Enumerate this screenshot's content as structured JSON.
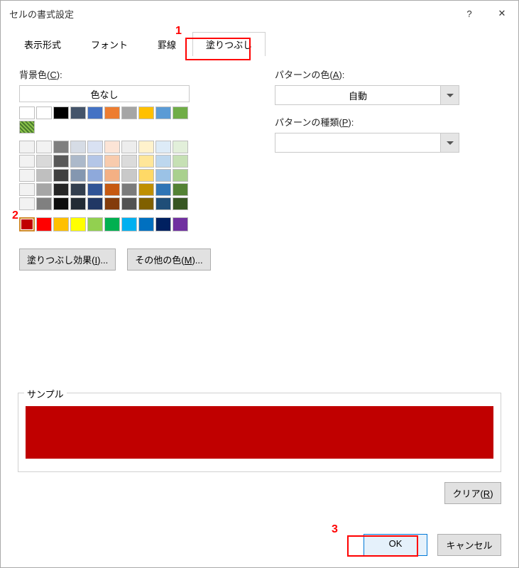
{
  "title": "セルの書式設定",
  "help_icon": "?",
  "close_icon": "✕",
  "tabs": {
    "t0": "表示形式",
    "t1": "フォント",
    "t2": "罫線",
    "t3": "塗りつぶし"
  },
  "bg": {
    "label_pre": "背景色(",
    "label_ul": "C",
    "label_post": "):",
    "nocolor": "色なし"
  },
  "fill_effects": {
    "pre": "塗りつぶし効果(",
    "ul": "I",
    "post": ")..."
  },
  "other_colors": {
    "pre": "その他の色(",
    "ul": "M",
    "post": ")..."
  },
  "pattern_color": {
    "pre": "パターンの色(",
    "ul": "A",
    "post": "):",
    "value": "自動"
  },
  "pattern_type": {
    "pre": "パターンの種類(",
    "ul": "P",
    "post": "):",
    "value": ""
  },
  "sample_label": "サンプル",
  "sample_color": "#c00000",
  "clear": {
    "pre": "クリア(",
    "ul": "R",
    "post": ")"
  },
  "ok": "OK",
  "cancel": "キャンセル",
  "annotations": {
    "a1": "1",
    "a2": "2",
    "a3": "3"
  },
  "palette_row1": [
    "#ffffff",
    "#000000",
    "#44546a",
    "#4472c4",
    "#ed7d31",
    "#a5a5a5",
    "#ffc000",
    "#5b9bd5",
    "#70ad47"
  ],
  "palette_grid": [
    [
      "#f2f2f2",
      "#7f7f7f",
      "#d6dce5",
      "#d9e1f2",
      "#fce4d6",
      "#ededed",
      "#fff2cc",
      "#ddebf7",
      "#e2efda"
    ],
    [
      "#d9d9d9",
      "#595959",
      "#acb9ca",
      "#b4c6e7",
      "#f8cbad",
      "#dbdbdb",
      "#ffe699",
      "#bdd7ee",
      "#c6e0b4"
    ],
    [
      "#bfbfbf",
      "#404040",
      "#8497b0",
      "#8ea9db",
      "#f4b084",
      "#c9c9c9",
      "#ffd966",
      "#9bc2e6",
      "#a9d08e"
    ],
    [
      "#a6a6a6",
      "#262626",
      "#333f4f",
      "#305496",
      "#c65911",
      "#7b7b7b",
      "#bf8f00",
      "#2f75b5",
      "#548235"
    ],
    [
      "#808080",
      "#0d0d0d",
      "#222b35",
      "#203764",
      "#833c0c",
      "#525252",
      "#806000",
      "#1f4e78",
      "#375623"
    ]
  ],
  "standard_colors": [
    "#c00000",
    "#ff0000",
    "#ffc000",
    "#ffff00",
    "#92d050",
    "#00b050",
    "#00b0f0",
    "#0070c0",
    "#002060",
    "#7030a0"
  ]
}
